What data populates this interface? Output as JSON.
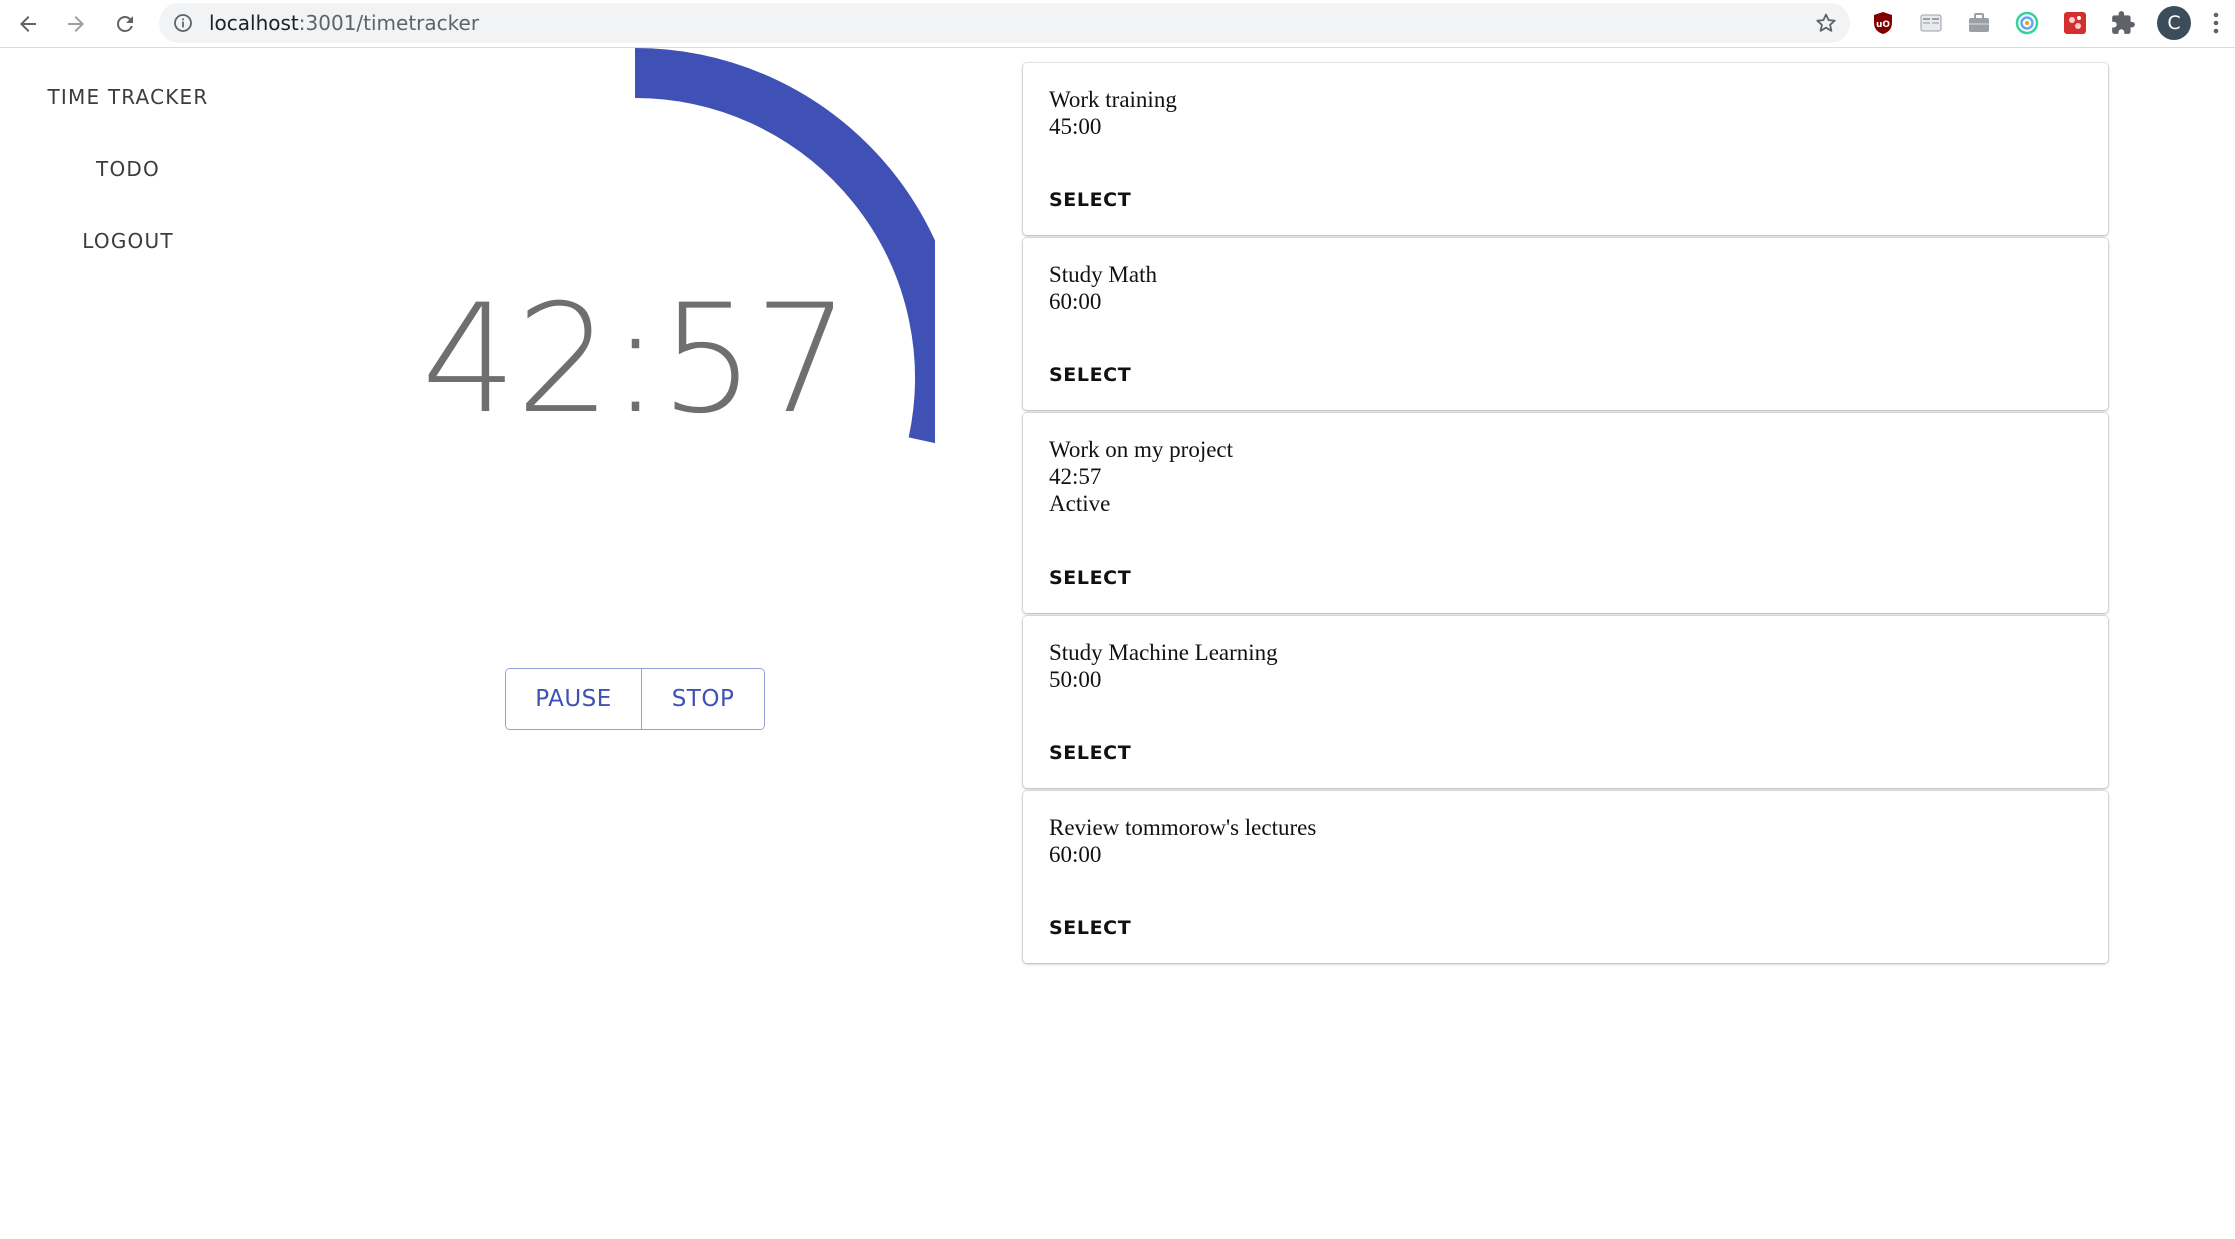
{
  "browser": {
    "url_host": "localhost",
    "url_path": ":3001/timetracker",
    "profile_initial": "C"
  },
  "nav": {
    "items": [
      {
        "label": "TIME TRACKER"
      },
      {
        "label": "TODO"
      },
      {
        "label": "LOGOUT"
      }
    ]
  },
  "timer": {
    "display": "42:57",
    "progress_fraction": 0.284,
    "ring_color": "#3f51b5",
    "pause_label": "PAUSE",
    "stop_label": "STOP"
  },
  "tasks": [
    {
      "title": "Work training",
      "duration": "45:00",
      "status": "",
      "action": "SELECT"
    },
    {
      "title": "Study Math",
      "duration": "60:00",
      "status": "",
      "action": "SELECT"
    },
    {
      "title": "Work on my project",
      "duration": "42:57",
      "status": "Active",
      "action": "SELECT"
    },
    {
      "title": "Study Machine Learning",
      "duration": "50:00",
      "status": "",
      "action": "SELECT"
    },
    {
      "title": "Review tommorow's lectures",
      "duration": "60:00",
      "status": "",
      "action": "SELECT"
    }
  ]
}
